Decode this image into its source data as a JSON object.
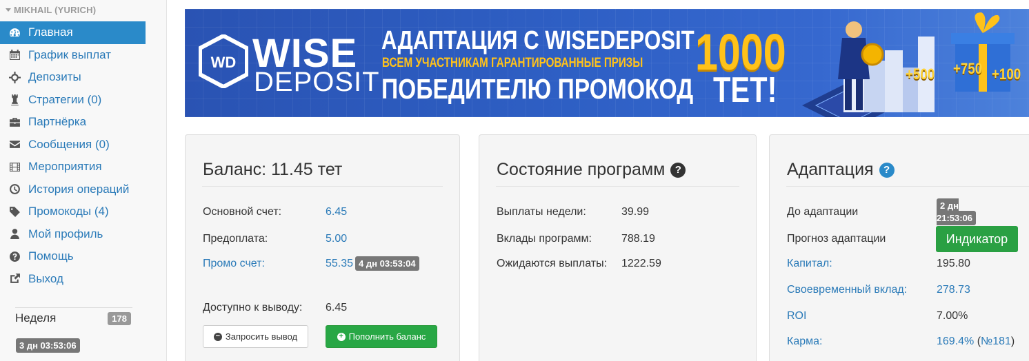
{
  "sidebar": {
    "user_name": "MIKHAIL (YURICH)",
    "items": [
      {
        "label": "Главная",
        "icon": "dashboard-icon",
        "active": true
      },
      {
        "label": "График выплат",
        "icon": "calendar-icon"
      },
      {
        "label": "Депозиты",
        "icon": "crosshairs-icon"
      },
      {
        "label": "Стратегии (0)",
        "icon": "chess-icon"
      },
      {
        "label": "Партнёрка",
        "icon": "briefcase-icon"
      },
      {
        "label": "Сообщения (0)",
        "icon": "envelope-icon"
      },
      {
        "label": "Мероприятия",
        "icon": "film-icon"
      },
      {
        "label": "История операций",
        "icon": "clock-icon"
      },
      {
        "label": "Промокоды (4)",
        "icon": "tag-icon"
      },
      {
        "label": "Мой профиль",
        "icon": "user-icon"
      },
      {
        "label": "Помощь",
        "icon": "question-icon"
      },
      {
        "label": "Выход",
        "icon": "share-icon"
      }
    ],
    "week_label": "Неделя",
    "week_count": "178",
    "week_timer": "3 дн 03:53:06"
  },
  "banner": {
    "logo_wise": "WISE",
    "logo_deposit": "DEPOSIT",
    "line1": "АДАПТАЦИЯ С WISEDEPOSIT",
    "line2": "ВСЕМ УЧАСТНИКАМ ГАРАНТИРОВАННЫЕ ПРИЗЫ",
    "line3": "ПОБЕДИТЕЛЮ ПРОМОКОД",
    "amount": "1000",
    "currency": "ТЕТ!",
    "bonus1": "+500",
    "bonus2": "+750",
    "bonus3": "+100"
  },
  "balance": {
    "title": "Баланс: 11.45 тет",
    "main_label": "Основной счет:",
    "main_value": "6.45",
    "prepay_label": "Предоплата:",
    "prepay_value": "5.00",
    "promo_label": "Промо счет:",
    "promo_value": "55.35",
    "promo_timer": "4 дн 03:53:04",
    "withdraw_label": "Доступно к выводу:",
    "withdraw_value": "6.45",
    "request_button": "Запросить вывод",
    "topup_button": "Пополнить баланс"
  },
  "programs": {
    "title": "Состояние программ",
    "rows": [
      {
        "label": "Выплаты недели:",
        "value": "39.99"
      },
      {
        "label": "Вклады программ:",
        "value": "788.19"
      },
      {
        "label": "Ожидаются выплаты:",
        "value": "1222.59"
      }
    ]
  },
  "adaptation": {
    "title": "Адаптация",
    "until_label": "До адаптации",
    "until_timer": "2 дн 21:53:06",
    "forecast_label": "Прогноз адаптации",
    "indicator_button": "Индикатор",
    "capital_label": "Капитал:",
    "capital_value": "195.80",
    "timely_label": "Своевременный вклад:",
    "timely_value": "278.73",
    "roi_label": "ROI",
    "roi_value": "7.00%",
    "karma_label": "Карма:",
    "karma_value": "169.4%",
    "karma_rank_open": " (",
    "karma_rank": "№181",
    "karma_rank_close": ")"
  },
  "colors": {
    "accent": "#2a8ac9",
    "link": "#2a7ab8",
    "success": "#28a745",
    "badge": "#777777",
    "banner_blue": "#2e5fc4",
    "banner_gold": "#ffc21a"
  }
}
